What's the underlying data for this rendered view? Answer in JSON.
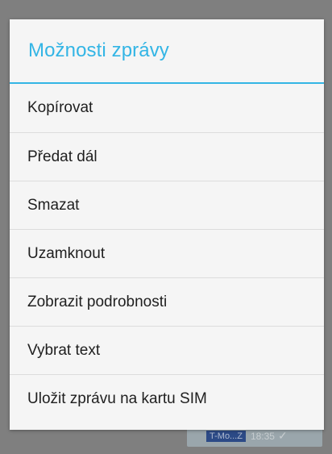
{
  "dialog": {
    "title": "Možnosti zprávy",
    "accent_color": "#33b5e5",
    "items": [
      {
        "label": "Kopírovat"
      },
      {
        "label": "Předat dál"
      },
      {
        "label": "Smazat"
      },
      {
        "label": "Uzamknout"
      },
      {
        "label": "Zobrazit podrobnosti"
      },
      {
        "label": "Vybrat text"
      },
      {
        "label": "Uložit zprávu na kartu SIM"
      }
    ]
  },
  "background_message": {
    "sender": "T-Mo...Z",
    "time": "18:35",
    "status_icon": "check-icon"
  }
}
